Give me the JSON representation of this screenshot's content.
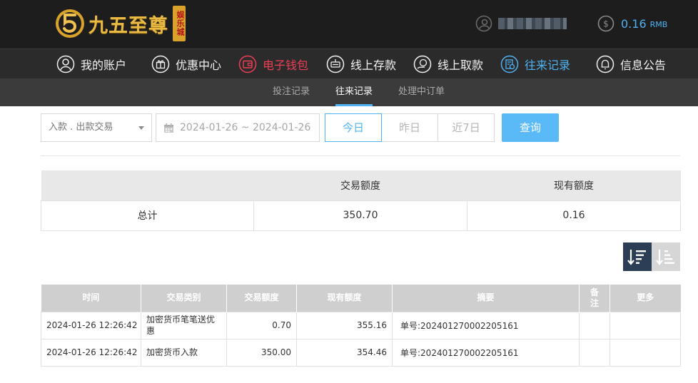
{
  "brand": {
    "logo_name": "九五至尊",
    "badge_text": "娱乐城",
    "colors": {
      "gold": "#e9b944",
      "accent": "#4fb3f3",
      "wallet_red": "#ee3f55",
      "header_bg": "#1d1d1d"
    }
  },
  "header": {
    "user_icon": "user-icon",
    "balance": {
      "amount": "0.16",
      "unit": "RMB",
      "icon": "coin-icon"
    }
  },
  "nav": {
    "items": [
      {
        "label": "我的账户",
        "icon": "user-circle-icon"
      },
      {
        "label": "优惠中心",
        "icon": "gift-icon"
      },
      {
        "label": "电子钱包",
        "icon": "wallet-icon"
      },
      {
        "label": "线上存款",
        "icon": "deposit-icon"
      },
      {
        "label": "线上取款",
        "icon": "withdraw-icon"
      },
      {
        "label": "往来记录",
        "icon": "records-icon"
      },
      {
        "label": "信息公告",
        "icon": "bell-icon"
      }
    ],
    "active": "往来记录"
  },
  "subnav": {
    "tabs": [
      "投注记录",
      "往来记录",
      "处理中订单"
    ],
    "active": "往来记录"
  },
  "filter": {
    "type_select": "入款 . 出款交易",
    "date_range": "2024-01-26 ~ 2024-01-26",
    "ranges": [
      "今日",
      "昨日",
      "近7日"
    ],
    "active_range": "今日",
    "query_label": "查询"
  },
  "summary": {
    "headers": [
      "",
      "交易额度",
      "现有额度"
    ],
    "row": {
      "label": "总计",
      "amount": "350.70",
      "balance": "0.16"
    }
  },
  "records": {
    "headers": [
      "时间",
      "交易类别",
      "交易额度",
      "现有额度",
      "摘要",
      "备注",
      "更多"
    ],
    "rows": [
      {
        "time": "2024-01-26 12:26:42",
        "category": "加密货币笔笔送优惠",
        "amount": "0.70",
        "balance": "355.16",
        "summary": "单号:202401270002205161",
        "note": "",
        "more": ""
      },
      {
        "time": "2024-01-26 12:26:42",
        "category": "加密货币入款",
        "amount": "350.00",
        "balance": "354.46",
        "summary": "单号:202401270002205161",
        "note": "",
        "more": ""
      }
    ]
  }
}
